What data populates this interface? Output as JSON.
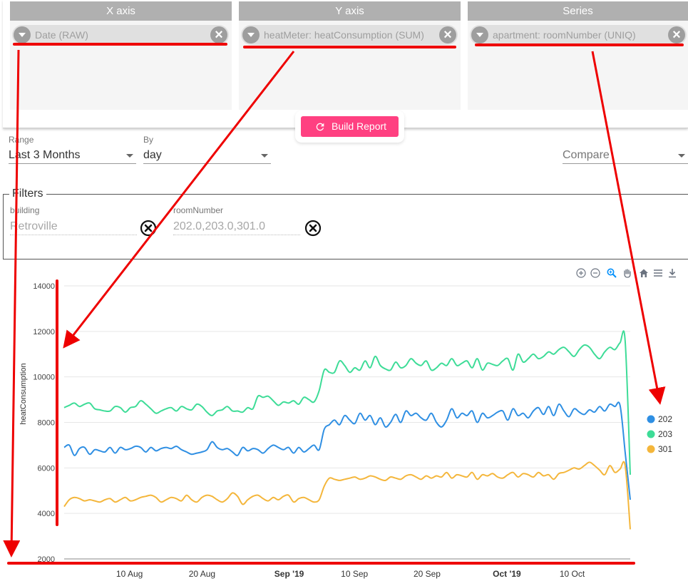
{
  "builder": {
    "columns": [
      {
        "title": "X axis",
        "chip": "Date (RAW)"
      },
      {
        "title": "Y axis",
        "chip": "heatMeter: heatConsumption (SUM)"
      },
      {
        "title": "Series",
        "chip": "apartment: roomNumber (UNIQ)"
      }
    ],
    "build_label": "Build Report"
  },
  "controls": {
    "range_label": "Range",
    "range_value": "Last 3 Months",
    "by_label": "By",
    "by_value": "day",
    "compare_placeholder": "Compare"
  },
  "filters": {
    "legend": "Filters",
    "items": [
      {
        "label": "building",
        "value": "Retroville"
      },
      {
        "label": "roomNumber",
        "value": "202.0,203.0,301.0"
      }
    ]
  },
  "toolbar": {
    "icons": [
      "zoom-in-icon",
      "zoom-out-icon",
      "zoom-selection-icon",
      "pan-hand-icon",
      "home-icon",
      "menu-icon",
      "download-icon"
    ]
  },
  "colors": {
    "accent": "#ff4081",
    "series_202": "#2f8fe3",
    "series_203": "#3ddc97",
    "series_301": "#f4b63b",
    "annotation": "#ee0000"
  },
  "chart_data": {
    "type": "line",
    "title": "",
    "xlabel": "",
    "ylabel": "heatConsumption",
    "ylim": [
      2000,
      14000
    ],
    "yticks": [
      2000,
      4000,
      6000,
      8000,
      10000,
      12000,
      14000
    ],
    "x_start_date": "2019-08-01",
    "x_end_date": "2019-10-18",
    "xticks": [
      {
        "label": "10 Aug",
        "date": "2019-08-10",
        "bold": false
      },
      {
        "label": "20 Aug",
        "date": "2019-08-20",
        "bold": false
      },
      {
        "label": "Sep '19",
        "date": "2019-09-01",
        "bold": true
      },
      {
        "label": "10 Sep",
        "date": "2019-09-10",
        "bold": false
      },
      {
        "label": "20 Sep",
        "date": "2019-09-20",
        "bold": false
      },
      {
        "label": "Oct '19",
        "date": "2019-10-01",
        "bold": true
      },
      {
        "label": "10 Oct",
        "date": "2019-10-10",
        "bold": false
      }
    ],
    "grid": true,
    "legend_position": "right",
    "series": [
      {
        "name": "202",
        "values": [
          6900,
          7000,
          6550,
          6850,
          6900,
          6600,
          6800,
          6750,
          6700,
          6900,
          6650,
          6900,
          6800,
          6850,
          6950,
          6900,
          6700,
          6900,
          6750,
          6850,
          6900,
          6850,
          6950,
          6800,
          6700,
          6600,
          6650,
          6700,
          6800,
          7150,
          6900,
          6800,
          6850,
          6700,
          6550,
          6900,
          6750,
          6850,
          6800,
          6650,
          6850,
          7000,
          6900,
          6800,
          6900,
          6650,
          6900,
          6700,
          6850,
          7000,
          6800,
          7700,
          7900,
          8100,
          7900,
          8300,
          8100,
          7950,
          8400,
          8100,
          8300,
          7900,
          8200,
          7800,
          8000,
          8350,
          8000,
          8500,
          8300,
          8400,
          8200,
          8100,
          8400,
          8000,
          7800,
          8100,
          8600,
          8200,
          8400,
          8300,
          8500,
          8000,
          8400,
          8200,
          8300,
          8450,
          8500,
          8100,
          8600,
          8300,
          8400,
          8200,
          8500,
          8650,
          8350,
          8700,
          8300,
          8800,
          8500,
          8250,
          8600,
          8450,
          8350,
          8550,
          8450,
          8700,
          8500,
          8800,
          8700,
          8750,
          6700,
          4600
        ],
        "color": "#2f8fe3"
      },
      {
        "name": "203",
        "values": [
          8650,
          8750,
          8850,
          8700,
          8800,
          8850,
          8600,
          8550,
          8500,
          8500,
          8700,
          8650,
          8450,
          8650,
          8700,
          8950,
          8800,
          8600,
          8400,
          8500,
          8600,
          8650,
          8500,
          8700,
          8600,
          8550,
          8800,
          8700,
          8450,
          8300,
          8500,
          8550,
          8700,
          8500,
          8500,
          8450,
          8650,
          8600,
          9150,
          9100,
          9150,
          8950,
          8750,
          8900,
          8850,
          8950,
          8800,
          9100,
          9000,
          8900,
          9400,
          10300,
          10200,
          10200,
          10700,
          10500,
          10200,
          10400,
          10300,
          10700,
          10400,
          10900,
          10500,
          10350,
          10300,
          10650,
          10400,
          10500,
          10800,
          10600,
          10500,
          10700,
          10300,
          10400,
          10600,
          10500,
          10800,
          10500,
          10600,
          10700,
          10400,
          10800,
          10300,
          10600,
          10550,
          10500,
          10700,
          10800,
          10300,
          11000,
          10650,
          10800,
          11000,
          10800,
          10900,
          11100,
          11000,
          11200,
          11300,
          11100,
          10900,
          11200,
          11400,
          11300,
          11000,
          10800,
          11100,
          11300,
          11200,
          11500,
          11600,
          5700
        ],
        "color": "#3ddc97"
      },
      {
        "name": "301",
        "values": [
          4300,
          4600,
          4700,
          4650,
          4550,
          4600,
          4550,
          4500,
          4600,
          4650,
          4500,
          4600,
          4700,
          4550,
          4600,
          4700,
          4750,
          4800,
          4700,
          4500,
          4600,
          4700,
          4650,
          4550,
          4800,
          4600,
          4500,
          4700,
          4800,
          4750,
          4600,
          4500,
          4650,
          4900,
          4750,
          4400,
          4600,
          4750,
          4800,
          4650,
          4550,
          4700,
          4600,
          4750,
          4800,
          4500,
          4650,
          4700,
          4600,
          4500,
          4600,
          5200,
          5550,
          5500,
          5450,
          5500,
          5550,
          5600,
          5500,
          5550,
          5650,
          5600,
          5500,
          5450,
          5600,
          5550,
          5500,
          5650,
          5700,
          5600,
          5500,
          5650,
          5550,
          5650,
          5600,
          5800,
          5550,
          5700,
          5650,
          5600,
          5800,
          5500,
          5700,
          5650,
          5750,
          5600,
          5550,
          5700,
          5800,
          5600,
          5750,
          5700,
          5600,
          5800,
          5650,
          5700,
          5500,
          5750,
          5800,
          5900,
          6000,
          5950,
          6100,
          6250,
          6100,
          5900,
          5700,
          6100,
          5800,
          5950,
          6100,
          3300
        ],
        "color": "#f4b63b"
      }
    ]
  }
}
